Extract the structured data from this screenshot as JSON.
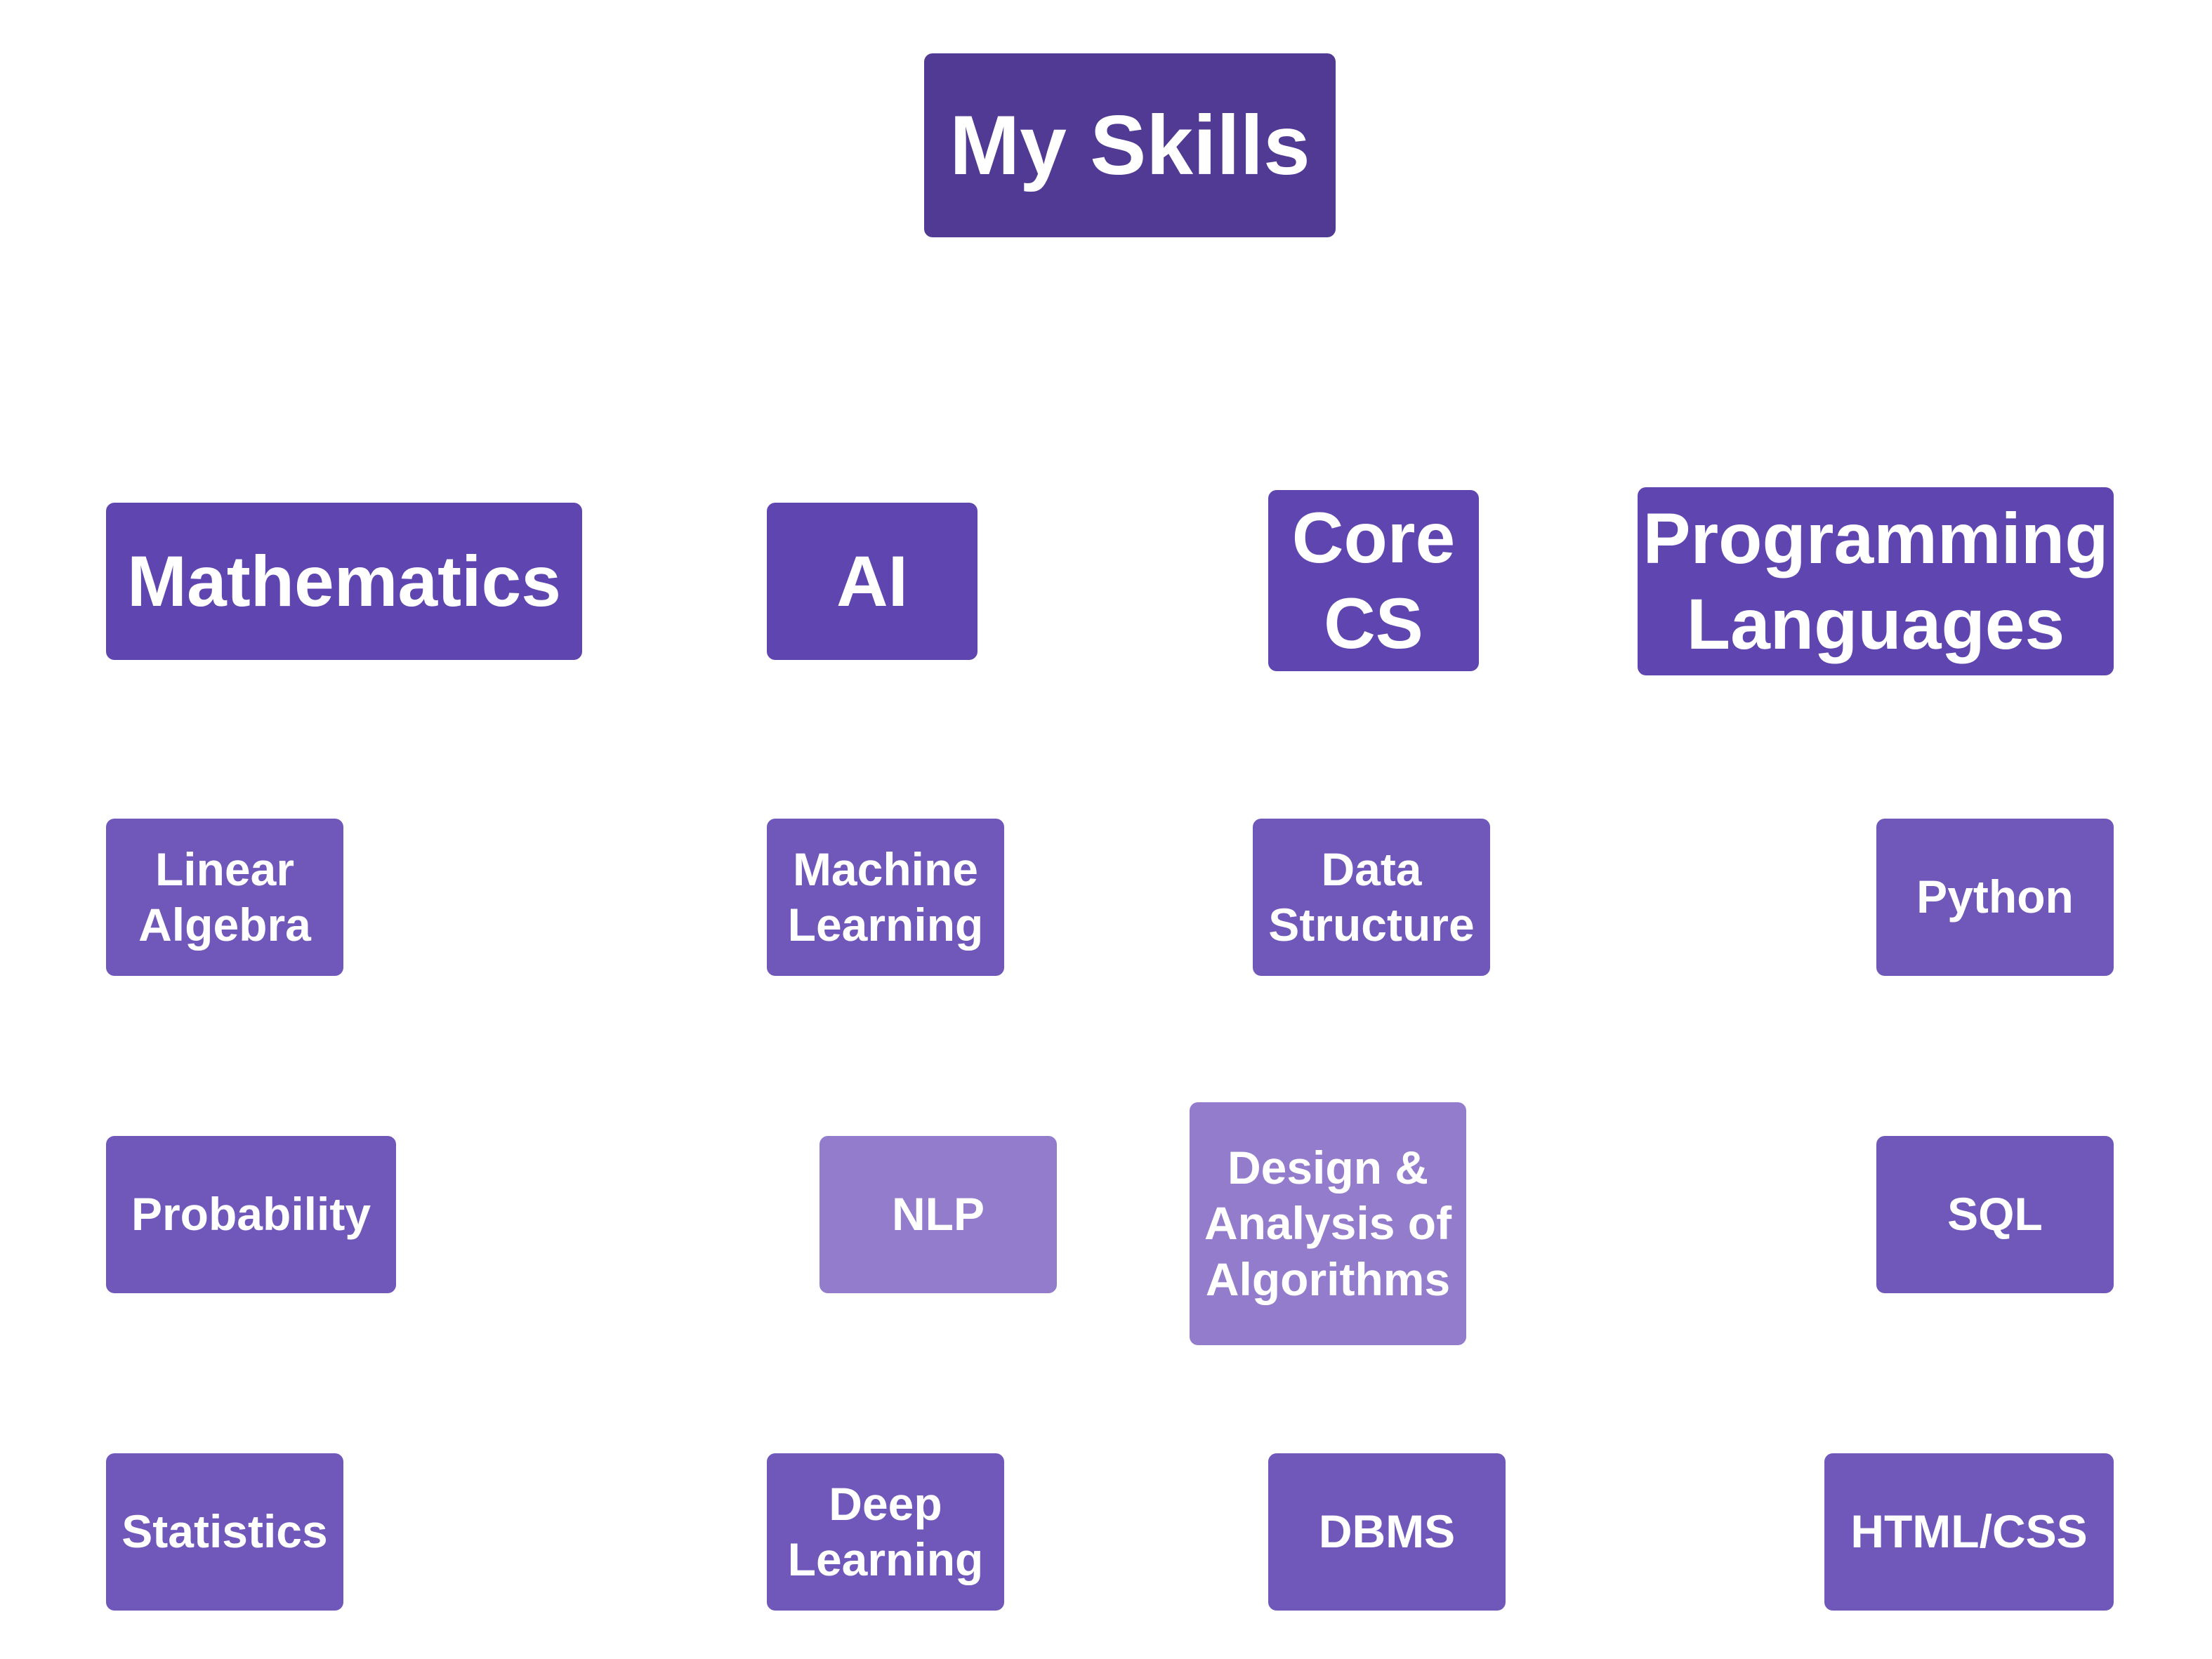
{
  "root": {
    "label": "My Skills"
  },
  "categories": [
    {
      "label": "Mathematics",
      "skills": [
        "Linear\nAlgebra",
        "Probability",
        "Statistics"
      ]
    },
    {
      "label": "AI",
      "skills": [
        "Machine\nLearning",
        "NLP",
        "Deep\nLearning"
      ]
    },
    {
      "label": "Core\nCS",
      "skills": [
        "Data\nStructure",
        "Design &\nAnalysis of\nAlgorithms",
        "DBMS"
      ]
    },
    {
      "label": "Programming\nLanguages",
      "skills": [
        "Python",
        "SQL",
        "HTML/CSS"
      ]
    }
  ],
  "colors": {
    "root": "#503a94",
    "category": "#5f45b0",
    "skill": "#7058ba",
    "skill_light": "#927ccb",
    "text": "#ffffff"
  }
}
